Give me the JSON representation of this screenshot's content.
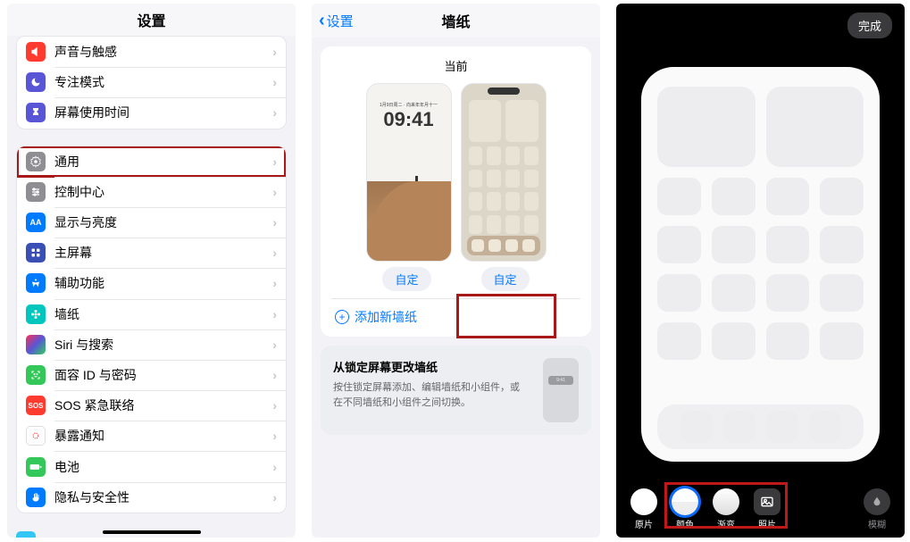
{
  "panel1": {
    "header_title": "设置",
    "group1": [
      {
        "label": "声音与触感"
      },
      {
        "label": "专注模式"
      },
      {
        "label": "屏幕使用时间"
      }
    ],
    "group2": [
      {
        "label": "通用"
      },
      {
        "label": "控制中心"
      },
      {
        "label": "显示与亮度"
      },
      {
        "label": "主屏幕"
      },
      {
        "label": "辅助功能"
      },
      {
        "label": "墙纸"
      },
      {
        "label": "Siri 与搜索"
      },
      {
        "label": "面容 ID 与密码"
      },
      {
        "label": "SOS 紧急联络"
      },
      {
        "label": "暴露通知"
      },
      {
        "label": "电池"
      },
      {
        "label": "隐私与安全性"
      }
    ],
    "sos_text": "SOS",
    "display_text": "AA"
  },
  "panel2": {
    "back_label": "设置",
    "title": "墙纸",
    "current_label": "当前",
    "lock_date": "1月9日周二 · 向来年年月十一",
    "lock_time": "09:41",
    "customize_label": "自定",
    "add_label": "添加新墙纸",
    "help_title": "从锁定屏幕更改墙纸",
    "help_body": "按住锁定屏幕添加、编辑墙纸和小组件，或在不同墙纸和小组件之间切换。",
    "mini_time": "9:41"
  },
  "panel3": {
    "done_label": "完成",
    "options": [
      {
        "key": "original",
        "label": "原片"
      },
      {
        "key": "color",
        "label": "颜色"
      },
      {
        "key": "gradient",
        "label": "渐变"
      },
      {
        "key": "photo",
        "label": "照片"
      }
    ],
    "blur_label": "模糊"
  }
}
